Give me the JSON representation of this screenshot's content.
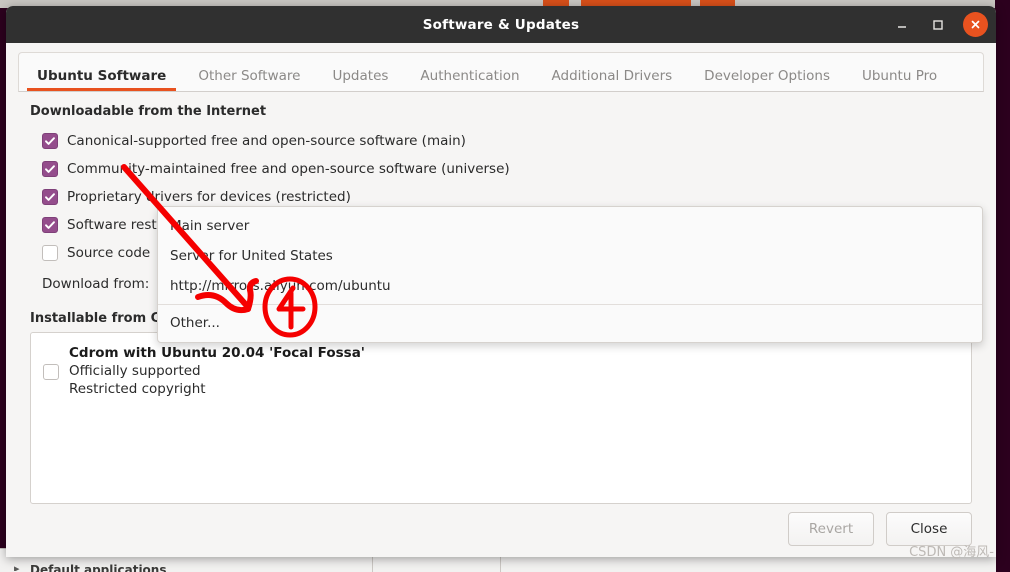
{
  "window": {
    "title": "Software & Updates",
    "buttons": {
      "minimize": "minimize-window",
      "maximize": "maximize-window",
      "close": "close-window"
    }
  },
  "tabs": [
    {
      "label": "Ubuntu Software",
      "active": true
    },
    {
      "label": "Other Software",
      "active": false
    },
    {
      "label": "Updates",
      "active": false
    },
    {
      "label": "Authentication",
      "active": false
    },
    {
      "label": "Additional Drivers",
      "active": false
    },
    {
      "label": "Developer Options",
      "active": false
    },
    {
      "label": "Ubuntu Pro",
      "active": false
    }
  ],
  "internet_section": {
    "title": "Downloadable from the Internet",
    "checkboxes": [
      {
        "label": "Canonical-supported free and open-source software (main)",
        "checked": true
      },
      {
        "label": "Community-maintained free and open-source software (universe)",
        "checked": true
      },
      {
        "label": "Proprietary drivers for devices (restricted)",
        "checked": true
      },
      {
        "label": "Software restricted by copyright or legal issues (multiverse)",
        "checked": true
      },
      {
        "label": "Source code",
        "checked": false
      }
    ],
    "download_from_label": "Download from:",
    "download_from_value": "http://mirrors.aliyun.com/ubuntu"
  },
  "dropdown": {
    "options": [
      "Main server",
      "Server for United States",
      "http://mirrors.aliyun.com/ubuntu"
    ],
    "other_option": "Other..."
  },
  "cdrom_section": {
    "title": "Installable from CD-ROM/DVD",
    "item": {
      "checked": false,
      "line1": "Cdrom with Ubuntu 20.04 'Focal Fossa'",
      "line2": "Officially supported",
      "line3": "Restricted copyright"
    }
  },
  "footer": {
    "revert_label": "Revert",
    "close_label": "Close"
  },
  "annotations": {
    "step_number": "4",
    "color": "#f50000"
  },
  "watermark": "CSDN @海风-",
  "background": {
    "bottom_item": "Default applications",
    "bottom_arrow": "▸"
  },
  "colors": {
    "accent_orange": "#e8521f",
    "checkbox_purple": "#944d8c",
    "titlebar": "#303030",
    "window_bg": "#f6f5f4",
    "desktop": "#2c001e"
  }
}
